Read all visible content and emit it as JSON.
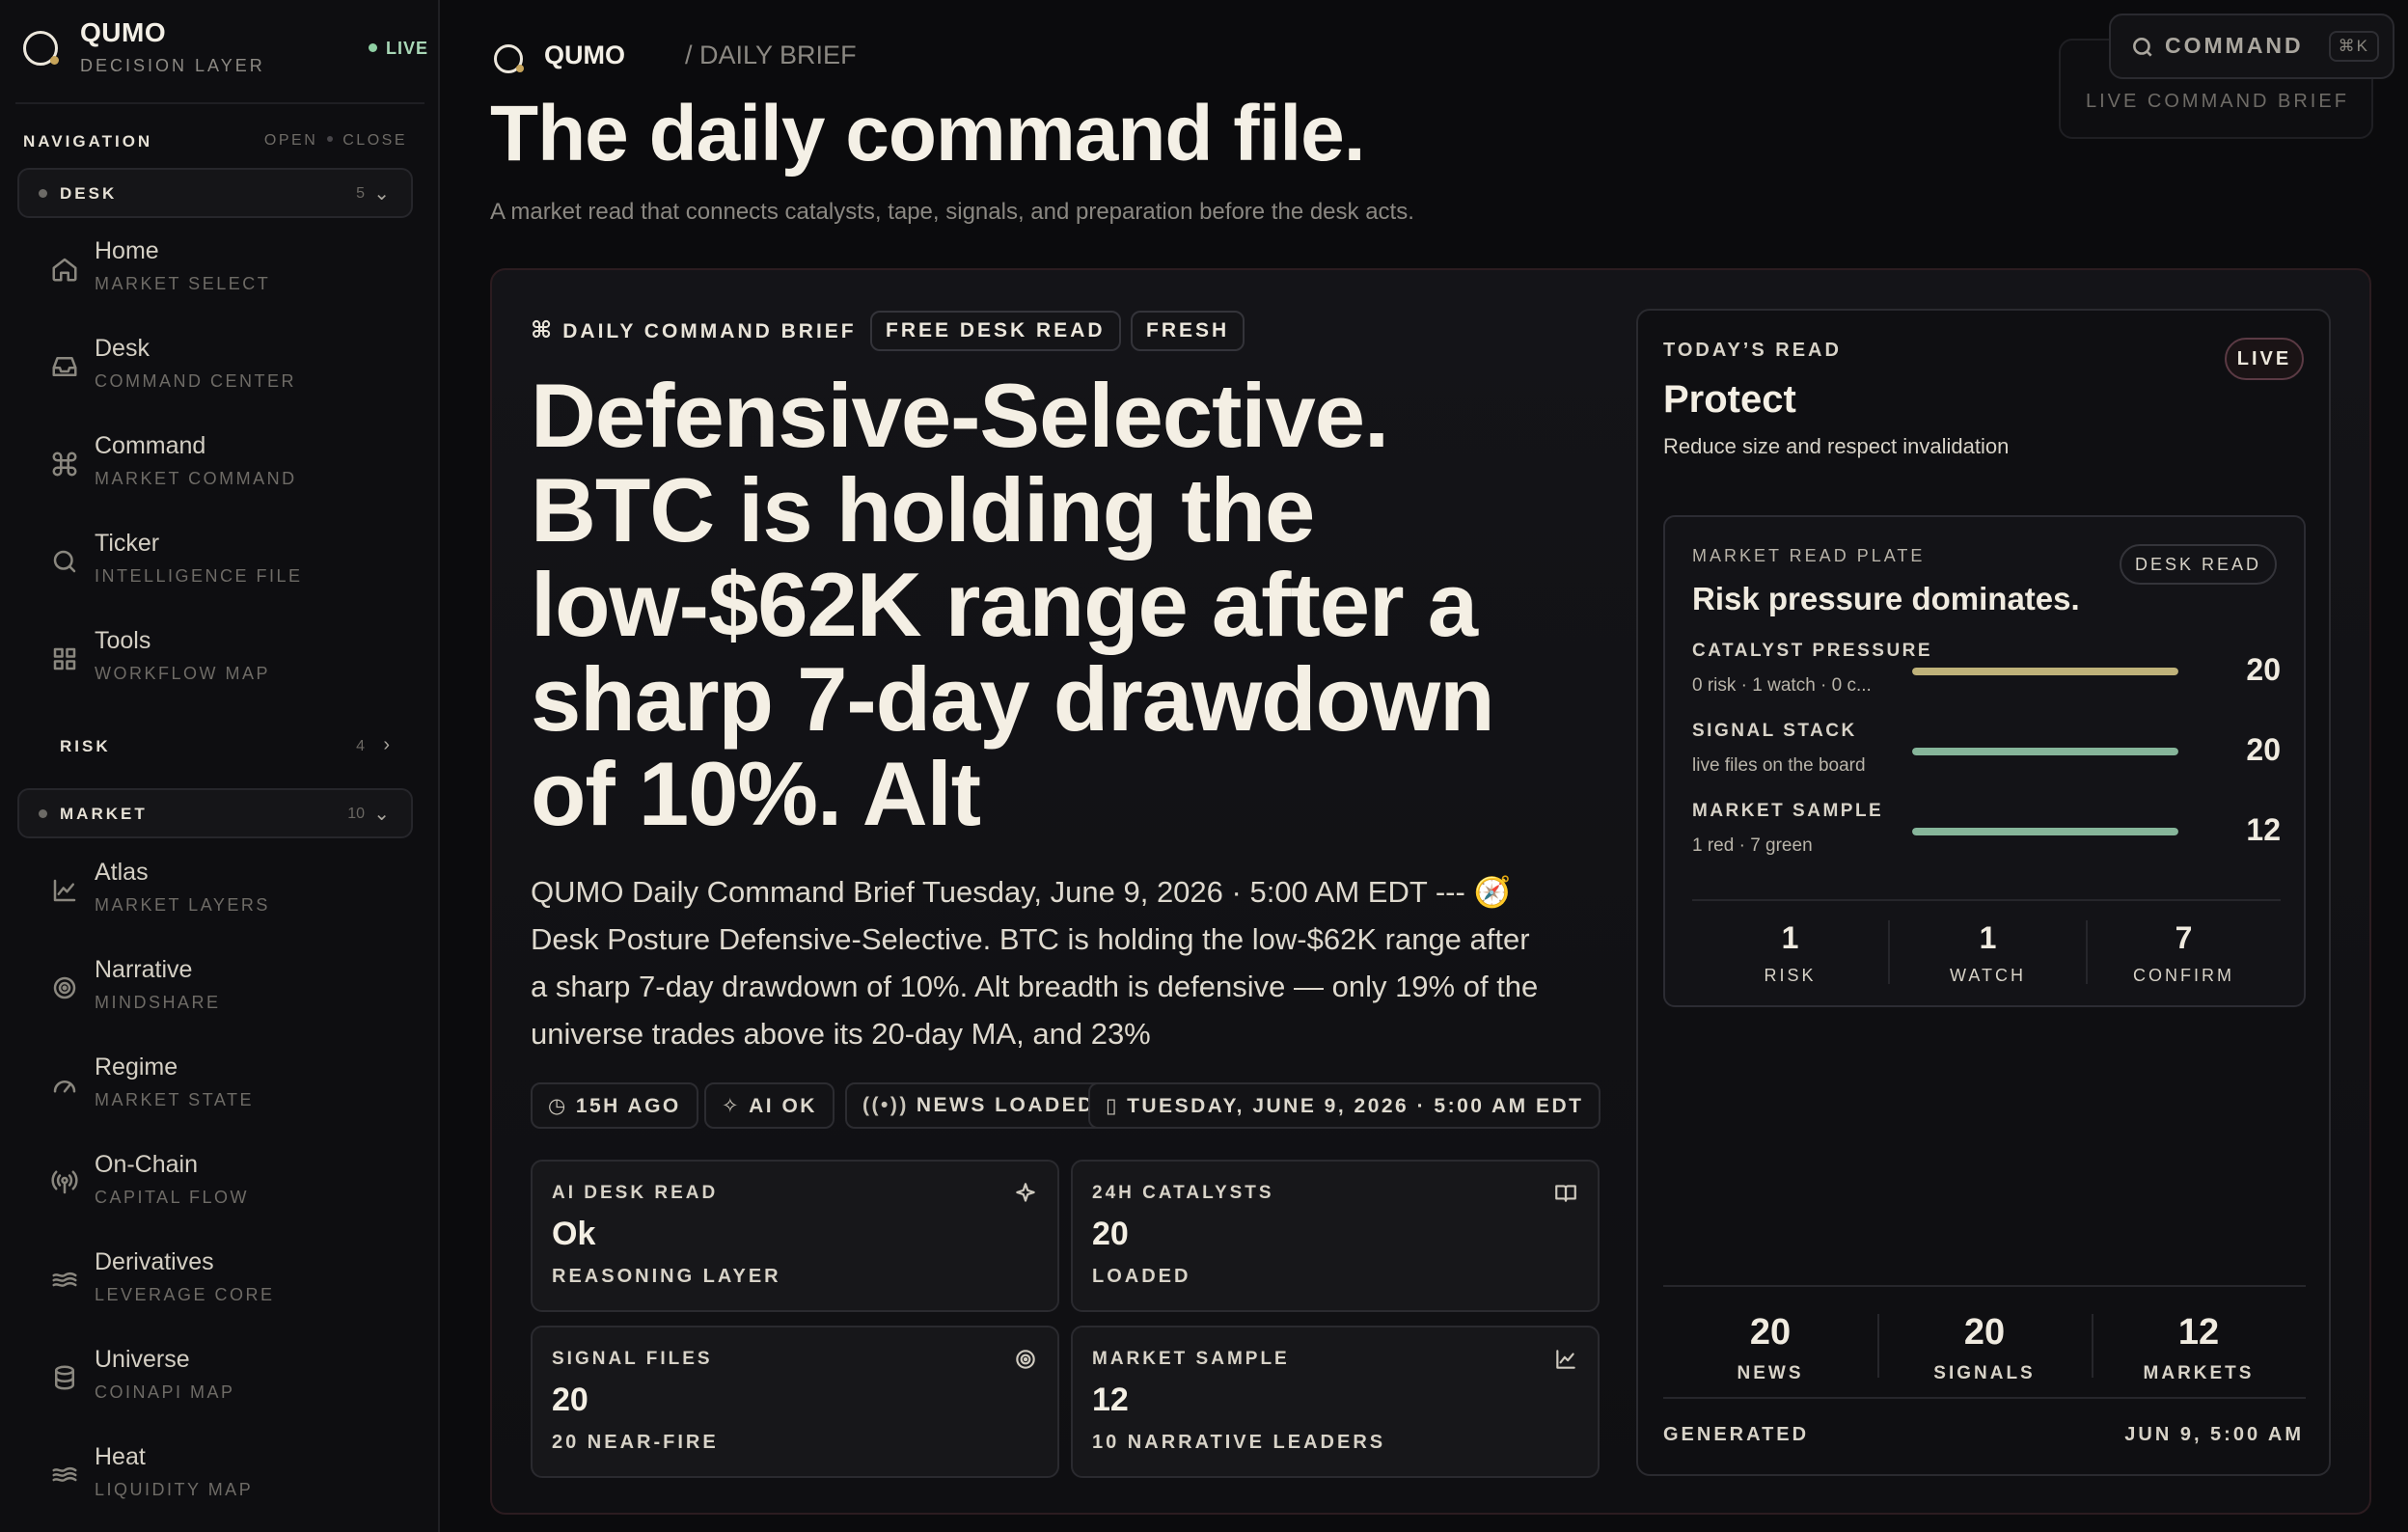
{
  "brand": {
    "name": "QUMO",
    "subtitle": "DECISION LAYER",
    "status": "LIVE"
  },
  "navigation": {
    "title": "NAVIGATION",
    "open_label": "OPEN",
    "close_label": "CLOSE",
    "groups": [
      {
        "label": "DESK",
        "count": "5"
      },
      {
        "label": "RISK",
        "count": "4"
      },
      {
        "label": "MARKET",
        "count": "10"
      }
    ],
    "desk_items": [
      {
        "label": "Home",
        "sub": "MARKET SELECT",
        "icon": "home-icon"
      },
      {
        "label": "Desk",
        "sub": "COMMAND CENTER",
        "icon": "inbox-icon"
      },
      {
        "label": "Command",
        "sub": "MARKET COMMAND",
        "icon": "command-icon"
      },
      {
        "label": "Ticker",
        "sub": "INTELLIGENCE FILE",
        "icon": "search-icon"
      },
      {
        "label": "Tools",
        "sub": "WORKFLOW MAP",
        "icon": "grid-icon"
      }
    ],
    "market_items": [
      {
        "label": "Atlas",
        "sub": "MARKET LAYERS",
        "icon": "chart-line-icon"
      },
      {
        "label": "Narrative",
        "sub": "MINDSHARE",
        "icon": "target-icon"
      },
      {
        "label": "Regime",
        "sub": "MARKET STATE",
        "icon": "gauge-icon"
      },
      {
        "label": "On-Chain",
        "sub": "CAPITAL FLOW",
        "icon": "broadcast-icon"
      },
      {
        "label": "Derivatives",
        "sub": "LEVERAGE CORE",
        "icon": "waves-icon"
      },
      {
        "label": "Universe",
        "sub": "COINAPI MAP",
        "icon": "database-icon"
      },
      {
        "label": "Heat",
        "sub": "LIQUIDITY MAP",
        "icon": "waves-icon"
      }
    ]
  },
  "header": {
    "crumb_brand": "QUMO",
    "crumb_path": "/ DAILY BRIEF",
    "title": "The daily command file.",
    "subtitle": "A market read that connects catalysts, tape, signals, and preparation before the desk acts.",
    "live_brief": "LIVE COMMAND BRIEF",
    "command_label": "COMMAND",
    "command_shortcut": "⌘K"
  },
  "brief": {
    "tag": "DAILY COMMAND BRIEF",
    "chips": [
      "FREE DESK READ",
      "FRESH"
    ],
    "headline": "Defensive-Selective. BTC is holding the low-$62K range after a sharp 7-day drawdown of 10%. Alt",
    "summary": "QUMO Daily Command Brief Tuesday, June 9, 2026 · 5:00 AM EDT --- 🧭 Desk Posture Defensive-Selective. BTC is holding the low-$62K range after a sharp 7-day drawdown of 10%. Alt breadth is defensive — only 19% of the universe trades above its 20-day MA, and 23%",
    "meta": [
      "15H AGO",
      "AI OK",
      "NEWS LOADED",
      "TUESDAY, JUNE 9, 2026 · 5:00 AM EDT"
    ],
    "stats": [
      {
        "label": "AI DESK READ",
        "value": "Ok",
        "sub": "REASONING LAYER",
        "icon": "sparkles-icon"
      },
      {
        "label": "24H CATALYSTS",
        "value": "20",
        "sub": "LOADED",
        "icon": "book-icon"
      },
      {
        "label": "SIGNAL FILES",
        "value": "20",
        "sub": "20 NEAR-FIRE",
        "icon": "target-icon"
      },
      {
        "label": "MARKET SAMPLE",
        "value": "12",
        "sub": "10 NARRATIVE LEADERS",
        "icon": "chart-line-icon"
      }
    ]
  },
  "todays_read": {
    "label": "TODAY’S READ",
    "title": "Protect",
    "subtitle": "Reduce size and respect invalidation",
    "badge": "LIVE",
    "plate": {
      "label": "MARKET READ PLATE",
      "title": "Risk pressure dominates.",
      "chip": "DESK READ",
      "meters": [
        {
          "label": "CATALYST PRESSURE",
          "sub": "0 risk · 1 watch · 0 c...",
          "value": "20",
          "fill": 1.0,
          "color": "#bfb27a"
        },
        {
          "label": "SIGNAL STACK",
          "sub": "live files on the board",
          "value": "20",
          "fill": 1.0,
          "color": "#86b59a"
        },
        {
          "label": "MARKET SAMPLE",
          "sub": "1 red · 7 green",
          "value": "12",
          "fill": 1.0,
          "color": "#86b59a"
        }
      ],
      "triad": [
        {
          "value": "1",
          "label": "RISK"
        },
        {
          "value": "1",
          "label": "WATCH"
        },
        {
          "value": "7",
          "label": "CONFIRM"
        }
      ]
    },
    "counts": [
      {
        "value": "20",
        "label": "NEWS"
      },
      {
        "value": "20",
        "label": "SIGNALS"
      },
      {
        "value": "12",
        "label": "MARKETS"
      }
    ],
    "generated_label": "GENERATED",
    "generated_value": "JUN 9, 5:00 AM"
  },
  "colors": {
    "background": "#0b0b0d",
    "accent_gold": "#c7a45a",
    "live_green": "#8fd0a4",
    "live_badge_border": "#5b3a44"
  }
}
